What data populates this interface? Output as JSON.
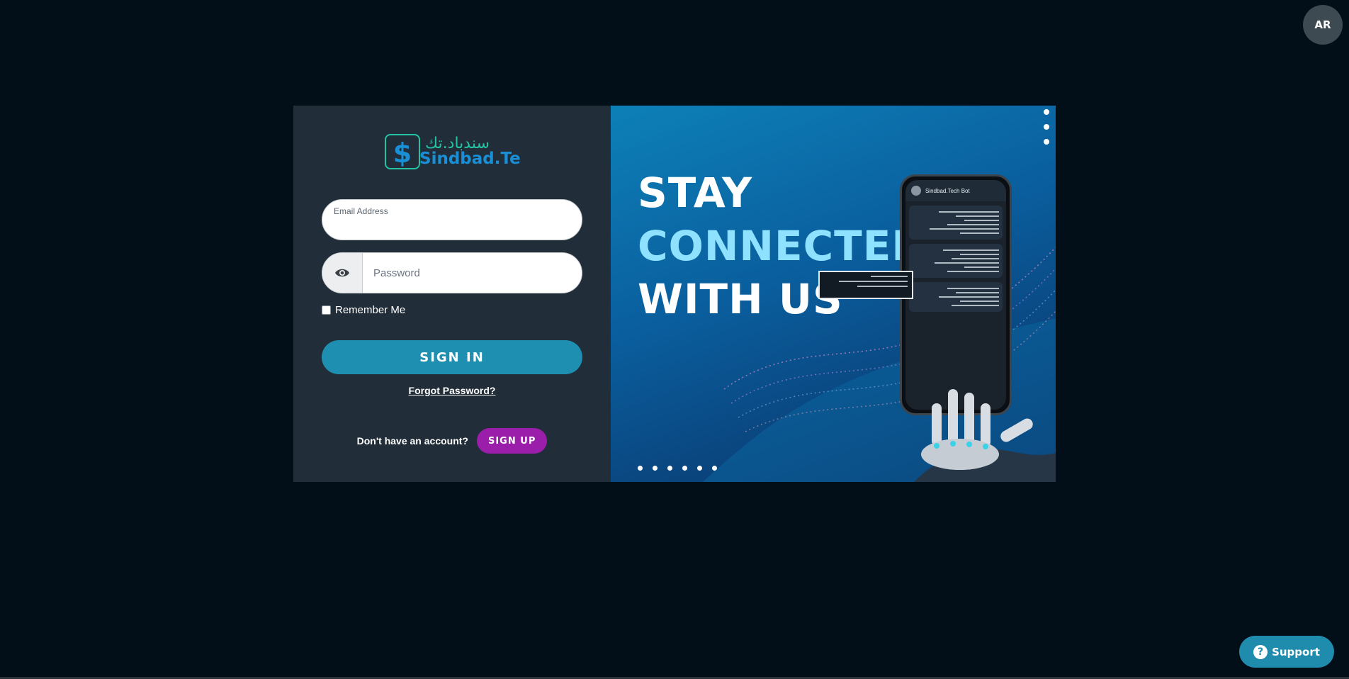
{
  "lang_toggle": "AR",
  "logo": {
    "arabic": "سندباد.تك",
    "latin": "Sindbad.Tech"
  },
  "form": {
    "email_label": "Email Address",
    "password_placeholder": "Password",
    "remember": "Remember Me",
    "signin": "SIGN IN",
    "forgot": "Forgot Password?",
    "no_account": "Don't have an account?",
    "signup": "SIGN UP"
  },
  "hero": {
    "line1": "STAY",
    "line2": "CONNECTED",
    "line3": "WITH US",
    "phone_title": "Sindbad.Tech Bot"
  },
  "support": "Support",
  "colors": {
    "background": "#020f18",
    "panel": "#212d38",
    "primary": "#1e8fb0",
    "signup": "#9a1ea9",
    "accent": "#8fe2ff"
  }
}
